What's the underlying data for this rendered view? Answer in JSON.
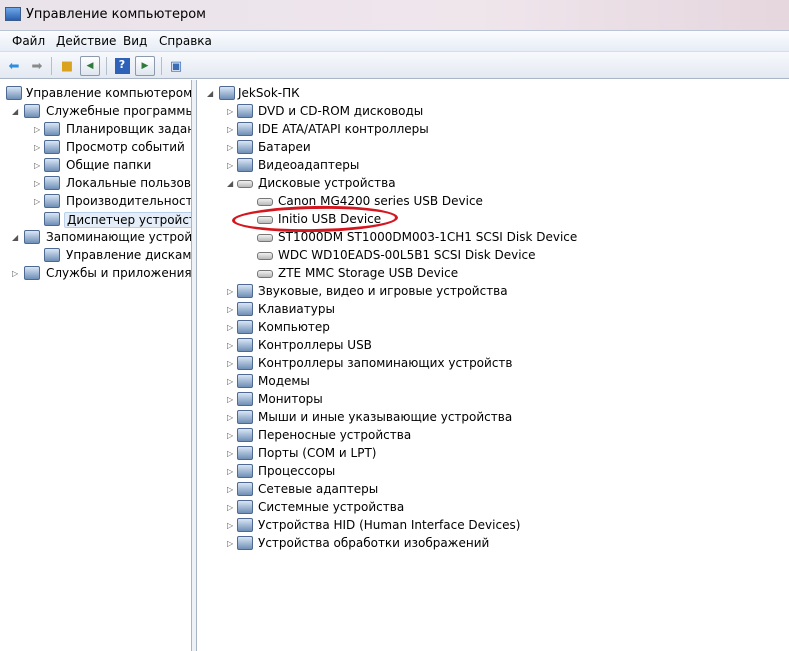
{
  "window": {
    "title": "Управление компьютером"
  },
  "menu": [
    "Файл",
    "Действие",
    "Вид",
    "Справка"
  ],
  "toolbar": {
    "icons": [
      "back-icon",
      "forward-icon",
      "up-folder-icon",
      "show-hide-tree-icon",
      "help-icon",
      "show-hide-action-pane-icon",
      "properties-icon"
    ]
  },
  "left_tree": [
    {
      "label": "Управление компьютером (л",
      "level": 0,
      "toggle": "",
      "icon": "computer-management-icon"
    },
    {
      "label": "Служебные программы",
      "level": 1,
      "toggle": "expanded",
      "icon": "tools-icon"
    },
    {
      "label": "Планировщик заданий",
      "level": 2,
      "toggle": "collapsed",
      "icon": "clock-icon"
    },
    {
      "label": "Просмотр событий",
      "level": 2,
      "toggle": "collapsed",
      "icon": "event-viewer-icon"
    },
    {
      "label": "Общие папки",
      "level": 2,
      "toggle": "collapsed",
      "icon": "shared-folders-icon"
    },
    {
      "label": "Локальные пользовате",
      "level": 2,
      "toggle": "collapsed",
      "icon": "users-icon"
    },
    {
      "label": "Производительность",
      "level": 2,
      "toggle": "collapsed",
      "icon": "performance-icon"
    },
    {
      "label": "Диспетчер устройств",
      "level": 2,
      "toggle": "",
      "icon": "device-manager-icon",
      "selected": true
    },
    {
      "label": "Запоминающие устройст",
      "level": 1,
      "toggle": "expanded",
      "icon": "storage-icon"
    },
    {
      "label": "Управление дисками",
      "level": 2,
      "toggle": "",
      "icon": "disk-management-icon"
    },
    {
      "label": "Службы и приложения",
      "level": 1,
      "toggle": "collapsed",
      "icon": "services-icon"
    }
  ],
  "device_tree": [
    {
      "label": "JekSok-ПК",
      "level": 0,
      "toggle": "expanded",
      "icon": "computer-icon"
    },
    {
      "label": "DVD и CD-ROM дисководы",
      "level": 1,
      "toggle": "collapsed",
      "icon": "dvd-icon"
    },
    {
      "label": "IDE ATA/ATAPI контроллеры",
      "level": 1,
      "toggle": "collapsed",
      "icon": "ide-controller-icon"
    },
    {
      "label": "Батареи",
      "level": 1,
      "toggle": "collapsed",
      "icon": "battery-icon"
    },
    {
      "label": "Видеоадаптеры",
      "level": 1,
      "toggle": "collapsed",
      "icon": "display-adapter-icon"
    },
    {
      "label": "Дисковые устройства",
      "level": 1,
      "toggle": "expanded",
      "icon": "disk-drive-icon"
    },
    {
      "label": "Canon MG4200 series USB Device",
      "level": 2,
      "toggle": "",
      "icon": "disk-drive-icon"
    },
    {
      "label": "Initio USB Device",
      "level": 2,
      "toggle": "",
      "icon": "disk-drive-icon",
      "highlighted": true
    },
    {
      "label": "ST1000DM ST1000DM003-1CH1 SCSI Disk Device",
      "level": 2,
      "toggle": "",
      "icon": "disk-drive-icon"
    },
    {
      "label": "WDC WD10EADS-00L5B1 SCSI Disk Device",
      "level": 2,
      "toggle": "",
      "icon": "disk-drive-icon"
    },
    {
      "label": "ZTE MMC Storage USB Device",
      "level": 2,
      "toggle": "",
      "icon": "disk-drive-icon"
    },
    {
      "label": "Звуковые, видео и игровые устройства",
      "level": 1,
      "toggle": "collapsed",
      "icon": "speaker-icon"
    },
    {
      "label": "Клавиатуры",
      "level": 1,
      "toggle": "collapsed",
      "icon": "keyboard-icon"
    },
    {
      "label": "Компьютер",
      "level": 1,
      "toggle": "collapsed",
      "icon": "computer-icon"
    },
    {
      "label": "Контроллеры USB",
      "level": 1,
      "toggle": "collapsed",
      "icon": "usb-icon"
    },
    {
      "label": "Контроллеры запоминающих устройств",
      "level": 1,
      "toggle": "collapsed",
      "icon": "storage-controller-icon"
    },
    {
      "label": "Модемы",
      "level": 1,
      "toggle": "collapsed",
      "icon": "modem-icon"
    },
    {
      "label": "Мониторы",
      "level": 1,
      "toggle": "collapsed",
      "icon": "monitor-icon"
    },
    {
      "label": "Мыши и иные указывающие устройства",
      "level": 1,
      "toggle": "collapsed",
      "icon": "mouse-icon"
    },
    {
      "label": "Переносные устройства",
      "level": 1,
      "toggle": "collapsed",
      "icon": "portable-device-icon"
    },
    {
      "label": "Порты (COM и LPT)",
      "level": 1,
      "toggle": "collapsed",
      "icon": "port-icon"
    },
    {
      "label": "Процессоры",
      "level": 1,
      "toggle": "collapsed",
      "icon": "processor-icon"
    },
    {
      "label": "Сетевые адаптеры",
      "level": 1,
      "toggle": "collapsed",
      "icon": "network-adapter-icon"
    },
    {
      "label": "Системные устройства",
      "level": 1,
      "toggle": "collapsed",
      "icon": "system-device-icon"
    },
    {
      "label": "Устройства HID (Human Interface Devices)",
      "level": 1,
      "toggle": "collapsed",
      "icon": "hid-icon"
    },
    {
      "label": "Устройства обработки изображений",
      "level": 1,
      "toggle": "collapsed",
      "icon": "imaging-device-icon"
    }
  ]
}
